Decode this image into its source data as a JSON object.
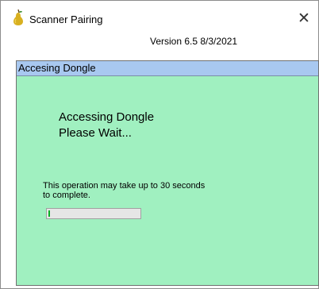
{
  "window": {
    "title": "Scanner Pairing",
    "close_glyph": "✕",
    "version": "Version 6.5 8/3/2021"
  },
  "panel": {
    "header": "Accesing Dongle",
    "message_line1": "Accessing Dongle",
    "message_line2": "Please Wait...",
    "info_line1": "This operation may take up to 30 seconds",
    "info_line2": "to complete.",
    "progress_fraction": 0.01,
    "progress_color": "#06b025",
    "background_color": "#a0f0c0",
    "header_color": "#a8c8f0"
  },
  "icons": {
    "app": "pear-icon",
    "close": "close-icon"
  }
}
